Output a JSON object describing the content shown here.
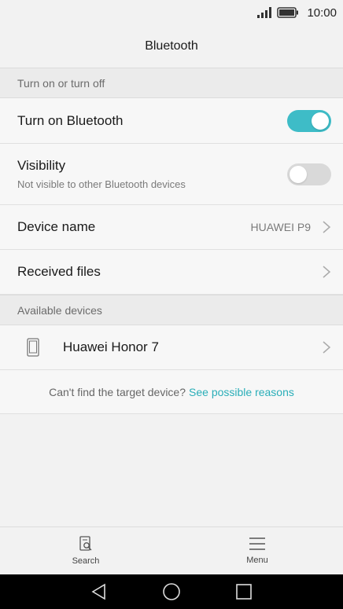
{
  "status_bar": {
    "time": "10:00"
  },
  "header": {
    "title": "Bluetooth"
  },
  "sections": {
    "toggle_section": "Turn on or turn off",
    "available_section": "Available devices"
  },
  "settings": {
    "bluetooth": {
      "label": "Turn on Bluetooth",
      "state": "on"
    },
    "visibility": {
      "label": "Visibility",
      "sub": "Not visible to other Bluetooth devices",
      "state": "off"
    },
    "device_name": {
      "label": "Device name",
      "value": "HUAWEI P9"
    },
    "received_files": {
      "label": "Received files"
    }
  },
  "devices": [
    {
      "name": "Huawei Honor 7",
      "icon": "phone-icon"
    }
  ],
  "help": {
    "text": "Can't find the target device?",
    "link": "See possible reasons"
  },
  "bottom_bar": {
    "search_label": "Search",
    "menu_label": "Menu"
  },
  "colors": {
    "accent": "#3ebcc7",
    "link": "#2aaeb8"
  }
}
